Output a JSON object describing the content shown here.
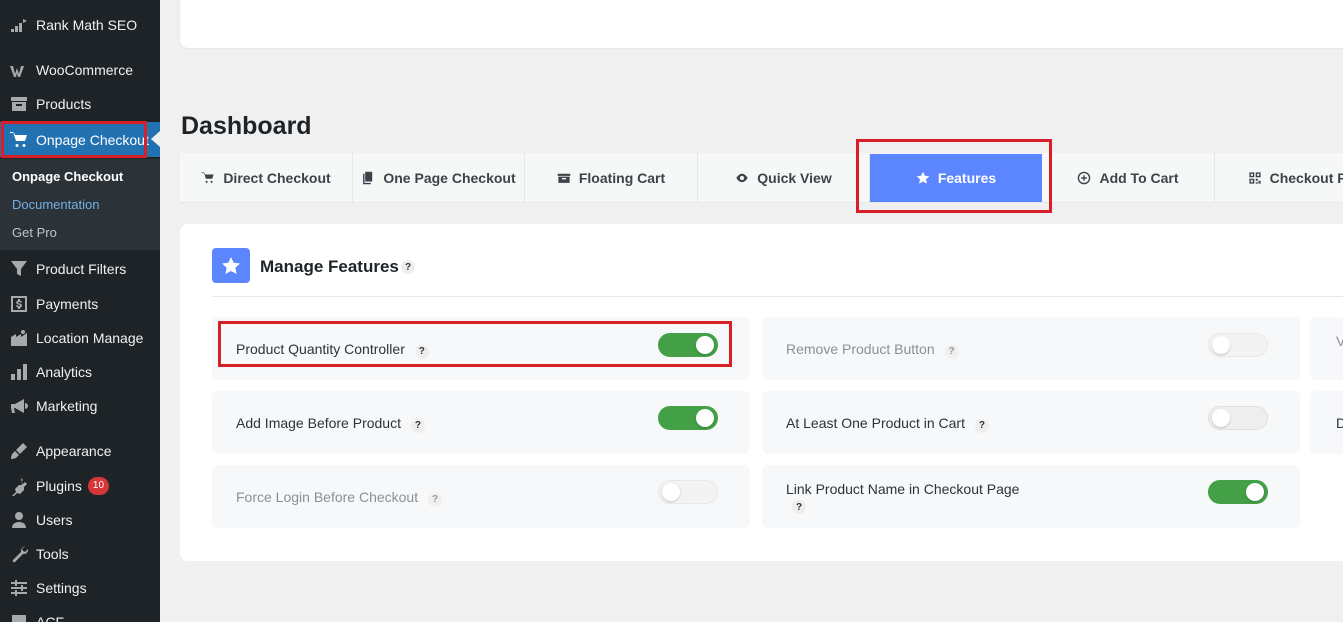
{
  "sidebar": {
    "items": [
      {
        "label": "Rank Math SEO",
        "icon": "rank-math-icon"
      },
      {
        "label": "WooCommerce",
        "icon": "woocommerce-icon"
      },
      {
        "label": "Products",
        "icon": "archive-icon"
      },
      {
        "label": "Onpage Checkout",
        "icon": "cart-icon"
      },
      {
        "label": "Product Filters",
        "icon": "filter-icon"
      },
      {
        "label": "Payments",
        "icon": "dollar-icon"
      },
      {
        "label": "Location Manage",
        "icon": "location-icon"
      },
      {
        "label": "Analytics",
        "icon": "bar-chart-icon"
      },
      {
        "label": "Marketing",
        "icon": "megaphone-icon"
      },
      {
        "label": "Appearance",
        "icon": "brush-icon"
      },
      {
        "label": "Plugins",
        "icon": "plugin-icon",
        "badge": "10"
      },
      {
        "label": "Users",
        "icon": "user-icon"
      },
      {
        "label": "Tools",
        "icon": "wrench-icon"
      },
      {
        "label": "Settings",
        "icon": "settings-icon"
      },
      {
        "label": "ACF",
        "icon": "acf-icon"
      }
    ],
    "submenu": [
      "Onpage Checkout",
      "Documentation",
      "Get Pro"
    ]
  },
  "page": {
    "title": "Dashboard"
  },
  "tabs": [
    {
      "label": "Direct Checkout",
      "icon": "cart-icon"
    },
    {
      "label": "One Page Checkout",
      "icon": "copy-icon"
    },
    {
      "label": "Floating Cart",
      "icon": "folder-icon"
    },
    {
      "label": "Quick View",
      "icon": "eye-icon"
    },
    {
      "label": "Features",
      "icon": "star-icon",
      "active": true
    },
    {
      "label": "Add To Cart",
      "icon": "plus-circle-icon"
    },
    {
      "label": "Checkout Fo",
      "icon": "qr-icon"
    }
  ],
  "manage": {
    "title": "Manage Features",
    "help": "?"
  },
  "features": [
    {
      "label": "Product Quantity Controller",
      "on": true,
      "disabled": false
    },
    {
      "label": "Remove Product Button",
      "on": false,
      "disabled": true
    },
    {
      "label": "Add Image Before Product",
      "on": true,
      "disabled": false
    },
    {
      "label": "At Least One Product in Cart",
      "on": false,
      "disabled": false
    },
    {
      "label": "Force Login Before Checkout",
      "on": false,
      "disabled": true
    },
    {
      "label": "Link Product Name in Checkout Page",
      "on": true,
      "disabled": false
    }
  ],
  "partial_features": [
    "V",
    "D"
  ],
  "colors": {
    "accent": "#5c86ff",
    "toggle_on": "#43a047",
    "sidebar": "#1d2327",
    "wp_blue": "#2271b1",
    "highlight": "#d61f26"
  }
}
